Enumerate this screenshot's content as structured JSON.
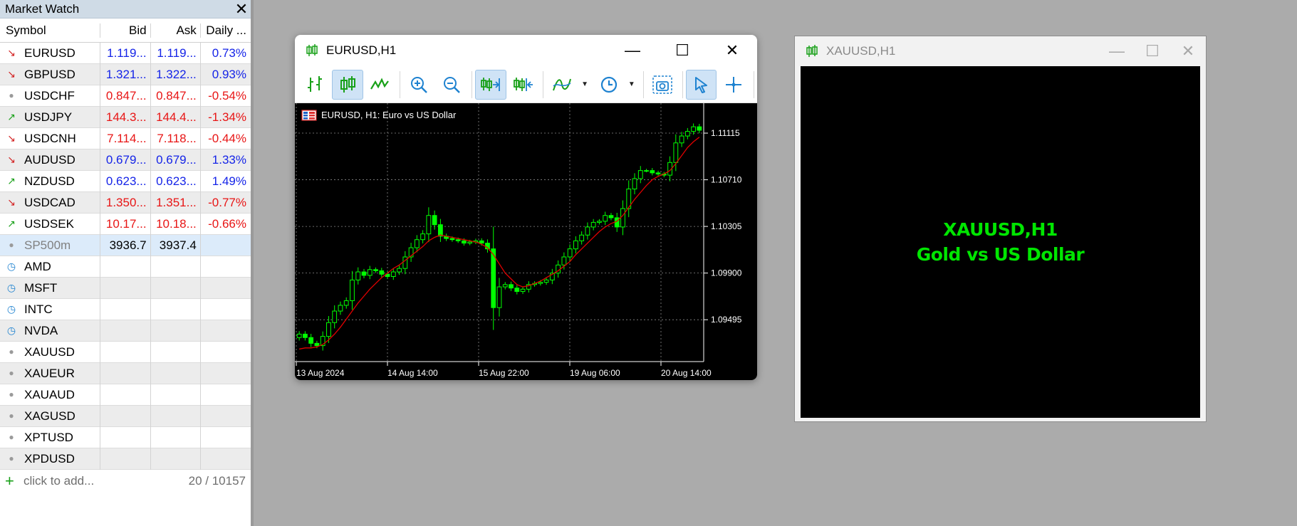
{
  "market_watch": {
    "title": "Market Watch",
    "columns": {
      "symbol": "Symbol",
      "bid": "Bid",
      "ask": "Ask",
      "daily": "Daily ..."
    },
    "rows": [
      {
        "icon": "arrow-down-red-icon",
        "symbol": "EURUSD",
        "bid": "1.119...",
        "ask": "1.119...",
        "daily": "0.73%",
        "color": "#1524e8"
      },
      {
        "icon": "arrow-down-red-icon",
        "symbol": "GBPUSD",
        "bid": "1.321...",
        "ask": "1.322...",
        "daily": "0.93%",
        "color": "#1524e8"
      },
      {
        "icon": "dot-icon",
        "symbol": "USDCHF",
        "bid": "0.847...",
        "ask": "0.847...",
        "daily": "-0.54%",
        "color": "#e81515"
      },
      {
        "icon": "arrow-up-green-icon",
        "symbol": "USDJPY",
        "bid": "144.3...",
        "ask": "144.4...",
        "daily": "-1.34%",
        "color": "#e81515"
      },
      {
        "icon": "arrow-down-red-icon",
        "symbol": "USDCNH",
        "bid": "7.114...",
        "ask": "7.118...",
        "daily": "-0.44%",
        "color": "#e81515"
      },
      {
        "icon": "arrow-down-red-icon",
        "symbol": "AUDUSD",
        "bid": "0.679...",
        "ask": "0.679...",
        "daily": "1.33%",
        "color": "#1524e8"
      },
      {
        "icon": "arrow-up-green-icon",
        "symbol": "NZDUSD",
        "bid": "0.623...",
        "ask": "0.623...",
        "daily": "1.49%",
        "color": "#1524e8"
      },
      {
        "icon": "arrow-down-red-icon",
        "symbol": "USDCAD",
        "bid": "1.350...",
        "ask": "1.351...",
        "daily": "-0.77%",
        "color": "#e81515"
      },
      {
        "icon": "arrow-up-green-icon",
        "symbol": "USDSEK",
        "bid": "10.17...",
        "ask": "10.18...",
        "daily": "-0.66%",
        "color": "#e81515"
      },
      {
        "icon": "dot-icon",
        "symbol": "SP500m",
        "bid": "3936.7",
        "ask": "3937.4",
        "daily": "",
        "color": "#000000",
        "selected": true
      },
      {
        "icon": "clock-icon",
        "symbol": "AMD",
        "bid": "",
        "ask": "",
        "daily": ""
      },
      {
        "icon": "clock-icon",
        "symbol": "MSFT",
        "bid": "",
        "ask": "",
        "daily": ""
      },
      {
        "icon": "clock-icon",
        "symbol": "INTC",
        "bid": "",
        "ask": "",
        "daily": ""
      },
      {
        "icon": "clock-icon",
        "symbol": "NVDA",
        "bid": "",
        "ask": "",
        "daily": ""
      },
      {
        "icon": "dot-icon",
        "symbol": "XAUUSD",
        "bid": "",
        "ask": "",
        "daily": ""
      },
      {
        "icon": "dot-icon",
        "symbol": "XAUEUR",
        "bid": "",
        "ask": "",
        "daily": ""
      },
      {
        "icon": "dot-icon",
        "symbol": "XAUAUD",
        "bid": "",
        "ask": "",
        "daily": ""
      },
      {
        "icon": "dot-icon",
        "symbol": "XAGUSD",
        "bid": "",
        "ask": "",
        "daily": ""
      },
      {
        "icon": "dot-icon",
        "symbol": "XPTUSD",
        "bid": "",
        "ask": "",
        "daily": ""
      },
      {
        "icon": "dot-icon",
        "symbol": "XPDUSD",
        "bid": "",
        "ask": "",
        "daily": ""
      }
    ],
    "footer": {
      "add_label": "click to add...",
      "count": "20 / 10157"
    }
  },
  "eurusd_window": {
    "title": "EURUSD,H1",
    "chart_header": "EURUSD, H1:  Euro vs US Dollar",
    "toolbar": [
      "bar-chart-icon",
      "candlestick-icon",
      "line-chart-icon",
      "zoom-in-icon",
      "zoom-out-icon",
      "autoscroll-icon",
      "chart-shift-icon",
      "indicators-icon",
      "timeframe-clock-icon",
      "screenshot-icon",
      "cursor-icon",
      "crosshair-icon"
    ]
  },
  "xauusd_window": {
    "title": "XAUUSD,H1",
    "body_line1": "XAUUSD,H1",
    "body_line2": "Gold vs US Dollar"
  },
  "chart_data": {
    "type": "candlestick",
    "title": "EURUSD, H1:  Euro vs US Dollar",
    "x_tick_labels": [
      "13 Aug 2024",
      "14 Aug 14:00",
      "15 Aug 22:00",
      "19 Aug 06:00",
      "20 Aug 14:00"
    ],
    "y_tick_labels": [
      "1.11115",
      "1.10710",
      "1.10305",
      "1.09900",
      "1.09495"
    ],
    "ylim": [
      1.0915,
      1.1135
    ],
    "grid": true,
    "series": [
      {
        "type": "candlestick",
        "color": "#00ff00",
        "close": [
          1.0937,
          1.0934,
          1.0929,
          1.0927,
          1.0935,
          1.0947,
          1.0957,
          1.0962,
          1.0966,
          1.0984,
          1.0991,
          1.0988,
          1.0993,
          1.0992,
          1.0989,
          1.0987,
          1.0991,
          1.0994,
          1.1004,
          1.1012,
          1.1019,
          1.1024,
          1.104,
          1.1032,
          1.1022,
          1.102,
          1.1019,
          1.1018,
          1.1016,
          1.1017,
          1.1018,
          1.1016,
          1.1011,
          1.096,
          1.0978,
          1.098,
          1.0977,
          1.0974,
          1.0976,
          1.098,
          1.0981,
          1.0982,
          1.0984,
          1.099,
          1.0997,
          1.1004,
          1.1011,
          1.1018,
          1.1023,
          1.103,
          1.1034,
          1.1035,
          1.104,
          1.1038,
          1.103,
          1.1046,
          1.1063,
          1.1072,
          1.1079,
          1.1079,
          1.1077,
          1.1076,
          1.1075,
          1.1086,
          1.1103,
          1.1109,
          1.1113,
          1.1117,
          1.1114
        ]
      },
      {
        "type": "moving-average",
        "color": "#e00000",
        "values": [
          1.0924,
          1.0925,
          1.0925,
          1.0926,
          1.0928,
          1.0932,
          1.0937,
          1.0943,
          1.095,
          1.0957,
          1.0964,
          1.097,
          1.0976,
          1.0981,
          1.0986,
          1.099,
          1.0994,
          1.0997,
          1.1001,
          1.1005,
          1.1009,
          1.1013,
          1.1018,
          1.1021,
          1.1023,
          1.1022,
          1.1021,
          1.102,
          1.1019,
          1.1018,
          1.1017,
          1.1015,
          1.1012,
          1.1006,
          1.0998,
          1.099,
          1.0985,
          1.098,
          1.0978,
          1.0979,
          1.0981,
          1.0983,
          1.0986,
          1.0989,
          1.0992,
          1.0996,
          1.1,
          1.1006,
          1.1011,
          1.1016,
          1.1021,
          1.1026,
          1.103,
          1.1033,
          1.1035,
          1.104,
          1.1047,
          1.1054,
          1.106,
          1.1066,
          1.1071,
          1.1074,
          1.1076,
          1.1079,
          1.1085,
          1.1092,
          1.1099,
          1.1104,
          1.1108
        ]
      }
    ]
  }
}
